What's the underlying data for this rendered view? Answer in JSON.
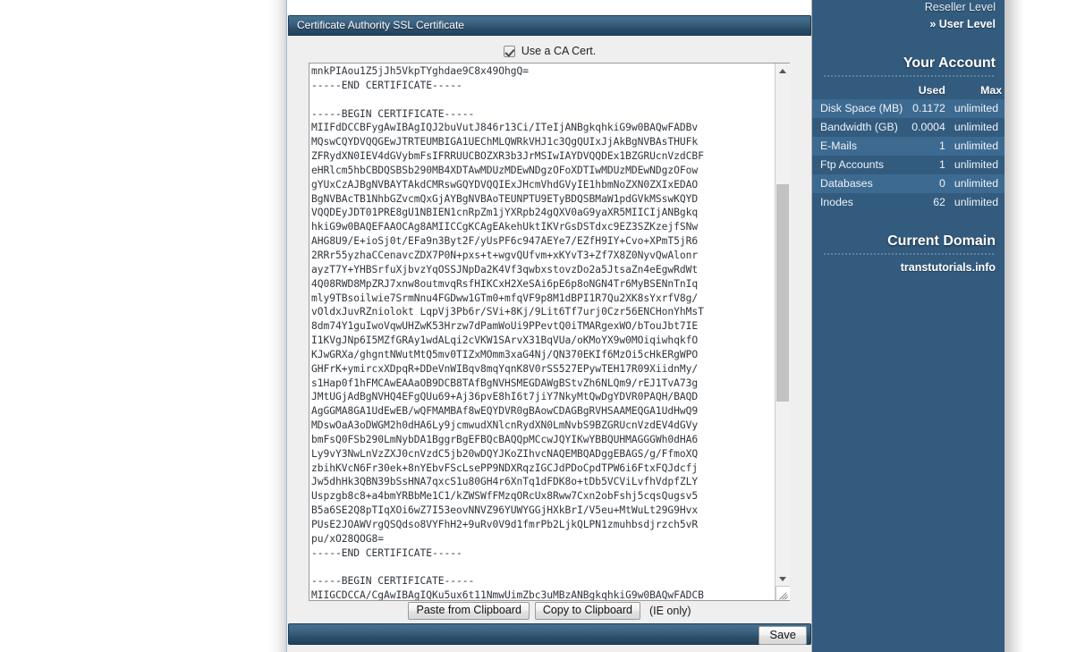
{
  "panel": {
    "title": "Certificate Authority SSL Certificate",
    "checkbox_label": "Use a CA Cert.",
    "checkbox_checked": "true",
    "cert_text": "mnkPIAou1Z5jJh5VkpTYghdae9C8x49OhgQ=\n-----END CERTIFICATE-----\n\n-----BEGIN CERTIFICATE-----\nMIIFdDCCBFygAwIBAgIQJ2buVutJ846r13Ci/ITeIjANBgkqhkiG9w0BAQwFADBv\nMQswCQYDVQQGEwJTRTEUMBIGA1UEChMLQWRkVHJ1c3QgQUIxJjAkBgNVBAsTHUFk\nZFRydXN0IEV4dGVybmFsIFRRUUCBOZXR3b3JrMSIwIAYDVQQDEx1BZGRUcnVzdCBF\neHRlcm5hbCBDQSBSb290MB4XDTAwMDUzMDEwNDgzOFoXDTIwMDUzMDEwNDgzOFow\ngYUxCzAJBgNVBAYTAkdCMRswGQYDVQQIExJHcmVhdGVyIE1hbmNoZXN0ZXIxEDAO\nBgNVBAcTB1NhbGZvcmQxGjAYBgNVBAoTEUNPTU9ETyBDQSBMaW1pdGVkMSswKQYD\nVQQDEyJDT01PRE8gU1NBIEN1cnRpZm1jYXRpb24gQXV0aG9yaXR5MIICIjANBgkq\nhkiG9w0BAQEFAAOCAg8AMIICCgKCAgEAkehUktIKVrGsDSTdxc9EZ3SZKzejfSNw\nAHG8U9/E+ioSj0t/EFa9n3Byt2F/yUsPF6c947AEYe7/EZfH9IY+Cvo+XPmT5jR6\n2RRr55yzhaCCenavcZDX7P0N+pxs+t+wgvQUfvm+xKYvT3+Zf7X8Z0NyvQwAlonr\nayzT7Y+YHBSrfuXjbvzYqOSSJNpDa2K4Vf3qwbxstovzDo2a5JtsaZn4eEgwRdWt\n4Q08RWD8MpZRJ7xnw8outmvqRsfHIKCxH2XeSAi6pE6p8oNGN4Tr6MyBSENnTnIq\nmly9TBsoilwie7SrmNnu4FGDww1GTm0+mfqVF9p8M1dBPI1R7Qu2XK8sYxrfV8g/\nvOldxJuvRZniolokt LqpVj3Pb6r/SVi+8Kj/9Lit6Tf7urj0Czr56ENCHonYhMsT\n8dm74Y1guIwoVqwUHZwK53Hrzw7dPamWoUi9PPevtQ0iTMARgexWO/bTouJbt7IE\nI1KVgJNp6I5MZfGRAy1wdALqi2cVKW1SArvX31BqVUa/oKMoYX9w0MOiqiwhqkfO\nKJwGRXa/ghgntNWutMtQ5mv0TIZxMOmm3xaG4Nj/QN370EKIf6MzOi5cHkERgWPO\nGHFrK+ymircxXDpqR+DDeVnWIBqv8mqYqnK8V0rSS527EPywTEH17R09XiidnMy/\ns1Hap0f1hFMCAwEAAaOB9DCB8TAfBgNVHSMEGDAWgBStvZh6NLQm9/rEJ1TvA73g\nJMtUGjAdBgNVHQ4EFgQUu69+Aj36pvE8hI6t7jiY7NkyMtQwDgYDVR0PAQH/BAQD\nAgGGMA8GA1UdEwEB/wQFMAMBAf8wEQYDVR0gBAowCDAGBgRVHSAAMEQGA1UdHwQ9\nMDswOaA3oDWGM2h0dHA6Ly9jcmwudXNlcnRydXN0LmNvbS9BZGRUcnVzdEV4dGVy\nbmFsQ0FSb290LmNybDA1BggrBgEFBQcBAQQpMCcwJQYIKwYBBQUHMAGGGWh0dHA6\nLy9vY3NwLnVzZXJ0cnVzdC5jb20wDQYJKoZIhvcNAQEMBQADggEBAGS/g/FfmoXQ\nzbihKVcN6Fr30ek+8nYEbvFScLsePP9NDXRqzIGCJdPDoCpdTPW6i6FtxFQJdcfj\nJw5dhHk3QBN39bSsHNA7qxcS1u80GH4r6XnTq1dFDK8o+tDb5VCViLvfhVdpfZLY\nUspzgb8c8+a4bmYRBbMe1C1/kZWSWfFMzqORcUx8Rww7Cxn2obFshj5cqsQugsv5\nB5a6SE2Q8pTIqXOi6wZ7I53eovNNVZ96YUWYGGjHXkBrI/V5eu+MtWuLt29G9Hvx\nPUsE2JOAWVrgQSQdso8VYFhH2+9uRv0V9d1fmrPb2LjkQLPN1zmuhbsdjrzch5vR\npu/xO28QOG8=\n-----END CERTIFICATE-----\n\n-----BEGIN CERTIFICATE-----\nMIIGCDCCA/CgAwIBAgIQKu5ux6t11NmwUimZbc3uMBzANBgkqhkiG9w0BAQwFADCB",
    "paste_button": "Paste from Clipboard",
    "copy_button": "Copy to Clipboard",
    "ie_note": "(IE only)",
    "save_button": "Save",
    "scrollbar": {
      "up_arrow": "triangle-up-icon",
      "down_arrow": "triangle-down-icon",
      "resize_grip": "resize-grip-icon"
    }
  },
  "sidebar": {
    "levels": [
      {
        "label": "Reseller Level",
        "active": "false"
      },
      {
        "label": "» User Level",
        "active": "true"
      }
    ],
    "account": {
      "heading": "Your Account",
      "columns": [
        "",
        "Used",
        "Max"
      ],
      "rows": [
        {
          "label": "Disk Space (MB)",
          "used": "0.1172",
          "max": "unlimited"
        },
        {
          "label": "Bandwidth (GB)",
          "used": "0.0004",
          "max": "unlimited"
        },
        {
          "label": "E-Mails",
          "used": "1",
          "max": "unlimited"
        },
        {
          "label": "Ftp Accounts",
          "used": "1",
          "max": "unlimited"
        },
        {
          "label": "Databases",
          "used": "0",
          "max": "unlimited"
        },
        {
          "label": "Inodes",
          "used": "62",
          "max": "unlimited"
        }
      ]
    },
    "current_domain": {
      "heading": "Current Domain",
      "domain": "transtutorials.info"
    }
  },
  "colors": {
    "sidebar_bg": "#335b7e",
    "sidebar_row_alt": "#3d6a91",
    "titlebar_top": "#47708f",
    "titlebar_bottom": "#22405a",
    "content_bg": "#efefef"
  }
}
